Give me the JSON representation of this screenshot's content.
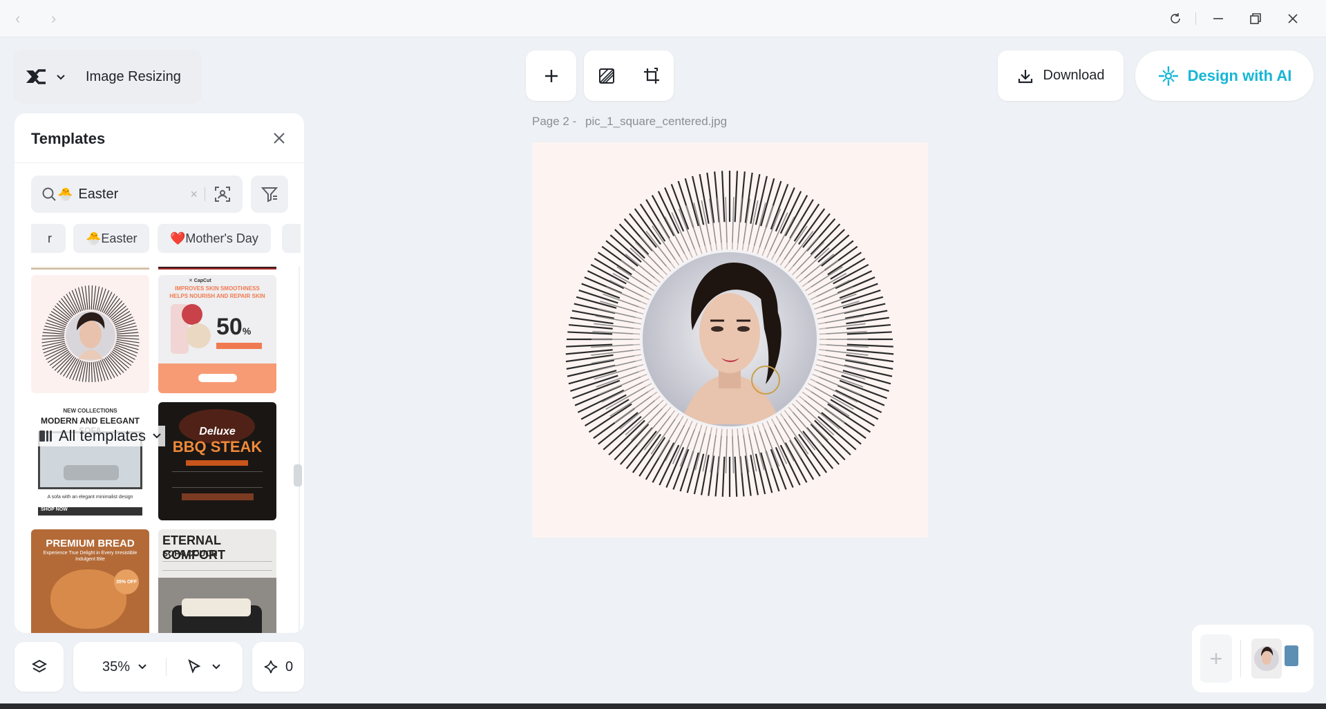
{
  "titlebar": {
    "back": "‹",
    "forward": "›"
  },
  "app": {
    "name": "Image Resizing"
  },
  "toolbar": {},
  "actions": {
    "download_label": "Download",
    "ai_label": "Design with AI"
  },
  "panel": {
    "title": "Templates",
    "search_value": "Easter",
    "search_clear": "×",
    "chips": [
      {
        "label": "r"
      },
      {
        "label": "Easter"
      },
      {
        "label": "Mother's Day"
      },
      {
        "label": ""
      }
    ],
    "all_templates_label": "All templates",
    "templates": [
      {
        "heading": "",
        "sub": ""
      },
      {
        "heading": "IMPROVES SKIN SMOOTHNESS",
        "sub": "HELPS NOURISH AND REPAIR SKIN",
        "big": "50",
        "unit": "%"
      },
      {
        "heading": "NEW COLLECTIONS",
        "sub": "MODERN AND ELEGANT SOFA",
        "caption": "A sofa with an elegant minimalist design",
        "cta": "SHOP NOW"
      },
      {
        "heading": "Deluxe",
        "sub": "BBQ STEAK"
      },
      {
        "heading": "PREMIUM BREAD",
        "sub": "Experience True Delight in Every Irresistible Indulgent Bite",
        "badge": "35% OFF"
      },
      {
        "heading": "ETERNAL COMFORT",
        "sub": "SOFA COUCH"
      }
    ]
  },
  "canvas": {
    "page_label": "Page 2 -",
    "file_name": "pic_1_square_centered.jpg"
  },
  "bottom": {
    "zoom": "35%",
    "magic_count": "0",
    "add_page": "+"
  },
  "colors": {
    "accent": "#15b6d6",
    "canvas_bg": "#fdf4f2",
    "panel_bg": "#ffffff",
    "app_bg": "#eef1f5"
  }
}
